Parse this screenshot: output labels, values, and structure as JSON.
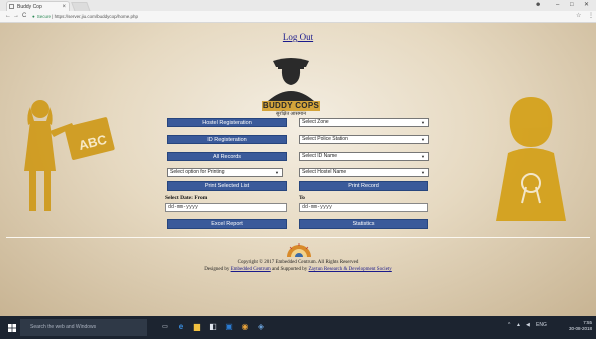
{
  "browser": {
    "tab_title": "Buddy Cop",
    "tab_close": "×",
    "min_label": "–",
    "max_label": "□",
    "close_label": "✕",
    "back": "←",
    "forward": "→",
    "reload": "C",
    "secure_label": "Secure",
    "url": "https://server.jiu.com/buddycop/home.php",
    "star": "☆",
    "menu": "⋮",
    "profile": "☻"
  },
  "page": {
    "logout": "Log Out",
    "logo_title": "BUDDY COPS",
    "logo_subtitle": "सुरक्षित आसमान",
    "buttons": {
      "hostel_registration": "Hostel Registeration",
      "id_registration": "ID Registeration",
      "all_records": "All Records",
      "print_selected_list": "Print Selected List",
      "print_record": "Print Record",
      "excel_report": "Excel Report",
      "statistics": "Statistics"
    },
    "selects": {
      "zone": "Select Zone",
      "police_station": "Select Police Station",
      "id_name": "Select ID Name",
      "printing_option": "Select option for Printing",
      "hostel_name": "Select Hostel Name"
    },
    "dates": {
      "from_label": "Select Date: From",
      "to_label": "To",
      "from_value": "dd-mm-yyyy",
      "to_value": "dd-mm-yyyy"
    },
    "footer": {
      "copyright": "Copyright © 2017 Embedded Centrum. All Rights Reserved",
      "designed_prefix": "Designed by ",
      "designed_by": "Embedded Centrum",
      "supported_prefix": " and Supported by ",
      "supported_by": "Zaytun Research & Development Society"
    }
  },
  "taskbar": {
    "search_placeholder": "Search the web and Windows",
    "time": "7:55",
    "date": "30-08-2018",
    "lang": "ENG"
  },
  "colors": {
    "button_bg": "#3a5a9a",
    "link": "#1a1a8c",
    "figure": "#d4a017"
  }
}
